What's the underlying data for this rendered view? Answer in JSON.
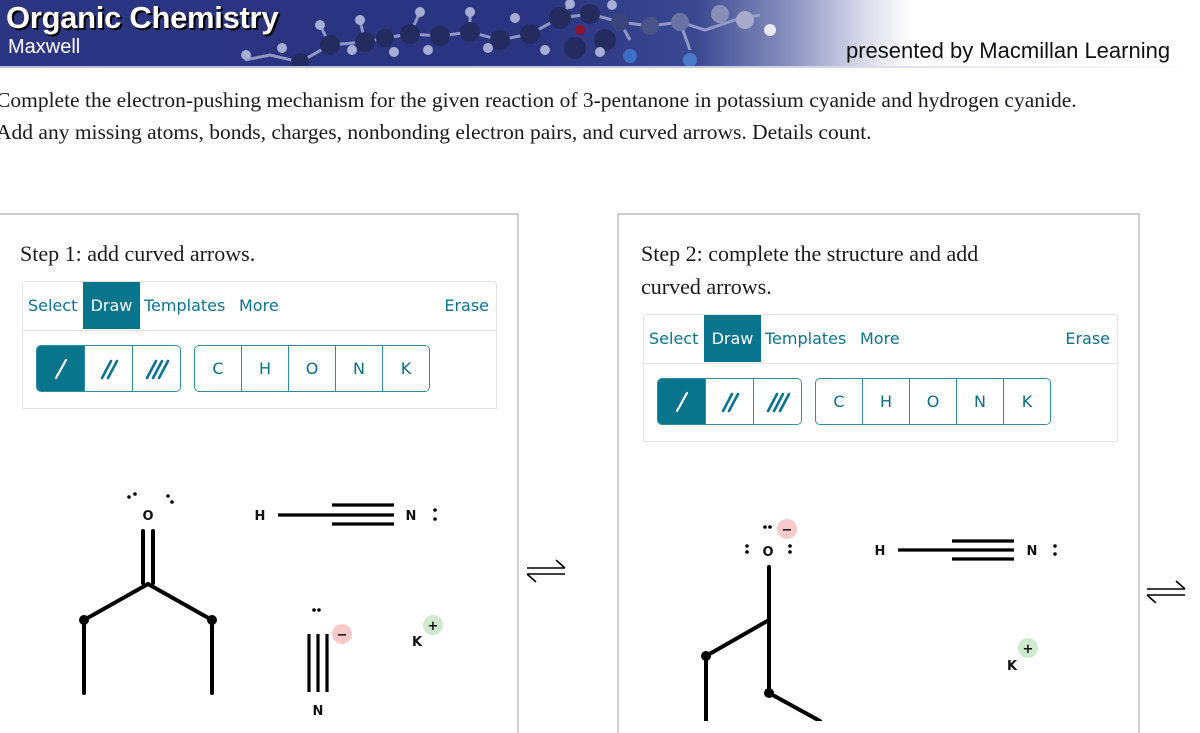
{
  "banner": {
    "title": "Organic Chemistry",
    "author": "Maxwell",
    "presented_by": "presented by Macmillan Learning",
    "background_color": "#2c3582"
  },
  "instructions": {
    "line1": "Complete the electron-pushing mechanism for the given reaction of 3-pentanone in potassium cyanide and hydrogen cyanide.",
    "line2": "Add any missing atoms, bonds, charges, nonbonding electron pairs, and curved arrows. Details count."
  },
  "accent_color": "#08758c",
  "steps": [
    {
      "title": "Step 1: add curved arrows.",
      "toolbar": {
        "tabs": [
          "Select",
          "Draw",
          "Templates",
          "More"
        ],
        "active_tab": "Draw",
        "erase": "Erase",
        "bond_tools": [
          "single-bond",
          "double-bond",
          "triple-bond"
        ],
        "active_bond": "single-bond",
        "atoms": [
          "C",
          "H",
          "O",
          "N",
          "K"
        ]
      },
      "canvas": {
        "ketone_oxygen": "O",
        "hcn": {
          "h": "H",
          "n": "N",
          "n_lone_pair": ":"
        },
        "cyanide": {
          "n": "N",
          "charge": "−"
        },
        "potassium": {
          "k": "K",
          "charge": "+"
        }
      },
      "equilibrium_arrow": "⇌"
    },
    {
      "title": "Step 2: complete the structure and add curved arrows.",
      "toolbar": {
        "tabs": [
          "Select",
          "Draw",
          "Templates",
          "More"
        ],
        "active_tab": "Draw",
        "erase": "Erase",
        "bond_tools": [
          "single-bond",
          "double-bond",
          "triple-bond"
        ],
        "active_bond": "single-bond",
        "atoms": [
          "C",
          "H",
          "O",
          "N",
          "K"
        ]
      },
      "canvas": {
        "alkoxide_oxygen": "O",
        "alkoxide_charge": "−",
        "hcn": {
          "h": "H",
          "n": "N",
          "n_lone_pair": ":"
        },
        "potassium": {
          "k": "K",
          "charge": "+"
        }
      },
      "equilibrium_arrow": "⇌"
    }
  ]
}
